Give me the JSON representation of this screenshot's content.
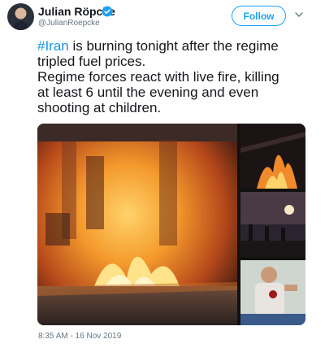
{
  "author": {
    "name": "Julian Röpcke",
    "handle": "@JulianRoepcke",
    "verified": true
  },
  "header": {
    "follow_label": "Follow"
  },
  "tweet": {
    "hashtag": "#Iran",
    "line1_rest": " is burning tonight after the regime",
    "line2": "tripled fuel prices.",
    "line3": "Regime forces react with live fire, killing",
    "line4": "at least 6 until the evening and even",
    "line5": "shooting at children."
  },
  "timestamp": "8:35 AM - 16 Nov 2019",
  "colors": {
    "accent": "#1da1f2",
    "hashtag": "#1b95e0",
    "secondary_text": "#657786"
  },
  "icons": {
    "verified": "verified-badge-icon",
    "menu": "chevron-down-icon"
  }
}
